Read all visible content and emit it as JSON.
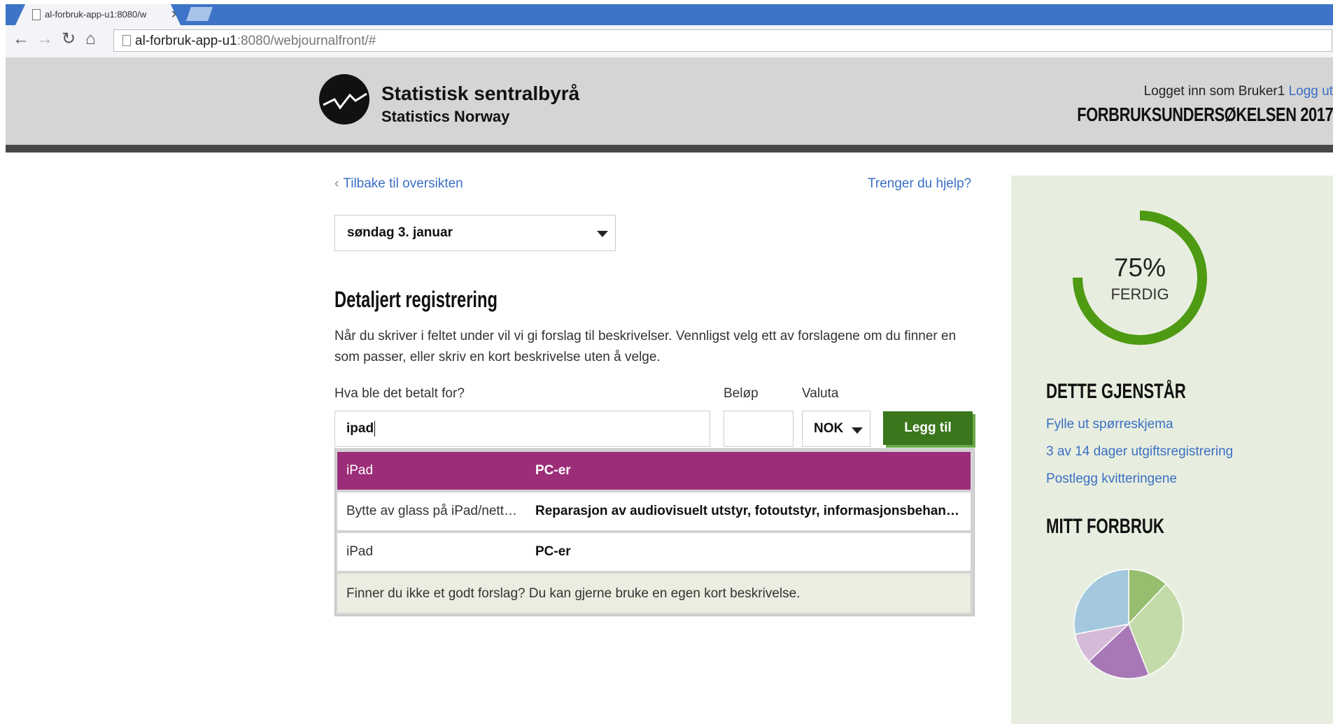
{
  "browser": {
    "tab_title": "al-forbruk-app-u1:8080/w",
    "url_host": "al-forbruk-app-u1",
    "url_path": ":8080/webjournalfront/#"
  },
  "header": {
    "org_name": "Statistisk sentralbyrå",
    "org_name_en": "Statistics Norway",
    "logged_in_text": "Logget inn som Bruker1",
    "logout_label": "Logg ut",
    "survey_title": "FORBRUKSUNDERSØKELSEN 2017"
  },
  "nav": {
    "back_label": "Tilbake til oversikten",
    "help_label": "Trenger du hjelp?"
  },
  "date_select": {
    "value": "søndag 3. januar"
  },
  "form": {
    "title": "Detaljert registrering",
    "intro": "Når du skriver i feltet under vil vi gi forslag til beskrivelser. Vennligst velg ett av forslagene om du finner en som passer, eller skriv en kort beskrivelse uten å velge.",
    "what_label": "Hva ble det betalt for?",
    "what_value": "ipad",
    "amount_label": "Beløp",
    "amount_value": "",
    "currency_label": "Valuta",
    "currency_value": "NOK",
    "add_label": "Legg til"
  },
  "suggestions": {
    "items": [
      {
        "name": "iPad",
        "category": "PC-er"
      },
      {
        "name": "Bytte av glass på iPad/nettbrett",
        "category": "Reparasjon av audiovisuelt utstyr, fotoutstyr, informasjonsbehandlingsutstyr"
      },
      {
        "name": "iPad",
        "category": "PC-er"
      }
    ],
    "footer": "Finner du ikke et godt forslag? Du kan gjerne bruke en egen kort beskrivelse."
  },
  "progress": {
    "percent_label": "75%",
    "fraction": 0.75,
    "status": "FERDIG",
    "color": "#4e9a12"
  },
  "remaining": {
    "title": "DETTE GJENSTÅR",
    "items": [
      "Fylle ut spørreskjema",
      "3 av 14 dager utgiftsregistrering",
      "Postlegg kvitteringene"
    ]
  },
  "spending": {
    "title": "MITT FORBRUK",
    "slices": [
      {
        "value": 12,
        "color": "#97bd6f"
      },
      {
        "value": 32,
        "color": "#c3dba9"
      },
      {
        "value": 19,
        "color": "#a878b6"
      },
      {
        "value": 9,
        "color": "#d4bcd9"
      },
      {
        "value": 28,
        "color": "#a4c8de"
      }
    ]
  }
}
